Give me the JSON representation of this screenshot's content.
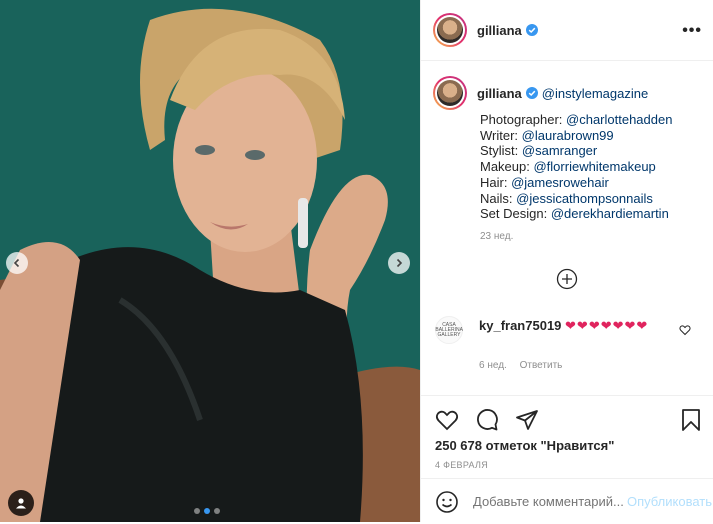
{
  "header": {
    "username": "gilliana",
    "more_label": "•••"
  },
  "caption": {
    "username": "gilliana",
    "mention": "@instylemagazine",
    "lines": [
      {
        "label": "Photographer: ",
        "handle": "@charlottehadden"
      },
      {
        "label": "Writer: ",
        "handle": "@laurabrown99"
      },
      {
        "label": "Stylist: ",
        "handle": "@samranger"
      },
      {
        "label": "Makeup: ",
        "handle": "@florriewhitemakeup"
      },
      {
        "label": "Hair: ",
        "handle": "@jamesrowehair"
      },
      {
        "label": "Nails: ",
        "handle": "@jessicathompsonnails"
      },
      {
        "label": "Set Design: ",
        "handle": "@derekhardiemartin"
      }
    ],
    "time": "23 нед."
  },
  "comment": {
    "avatar_text": "CASA BALLERINA GALLERY",
    "username": "ky_fran75019",
    "text": "❤❤❤❤❤❤❤",
    "time": "6 нед.",
    "reply_label": "Ответить"
  },
  "stats": {
    "likes": "250 678 отметок \"Нравится\"",
    "date": "4 ФЕВРАЛЯ"
  },
  "comment_bar": {
    "placeholder": "Добавьте комментарий...",
    "publish_label": "Опубликовать"
  },
  "carousel": {
    "slides": 3,
    "active_index": 1
  },
  "colors": {
    "photo_background": "#1b6b63",
    "link": "#00376b",
    "verified_badge": "#3897f0",
    "heart": "#e0245e",
    "publish_disabled": "#b2dffc",
    "muted": "#8e8e8e"
  }
}
